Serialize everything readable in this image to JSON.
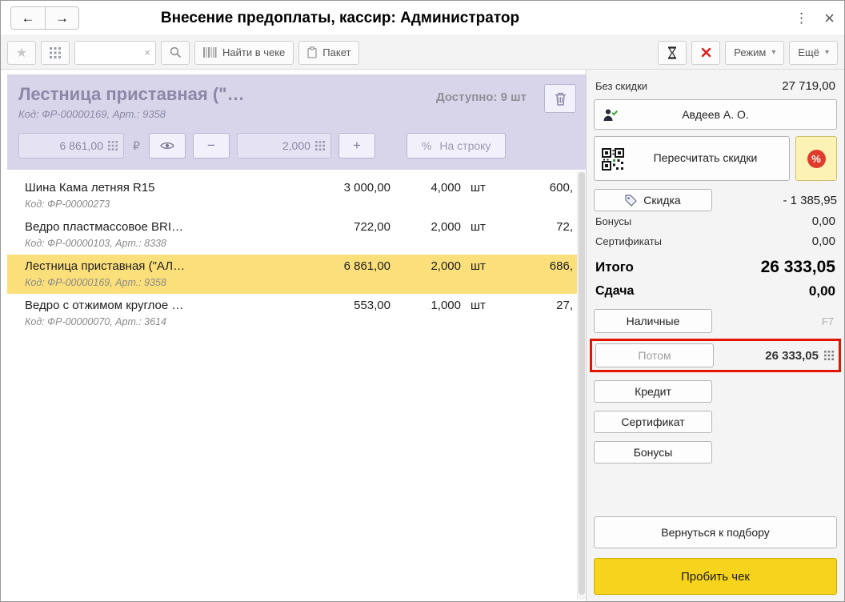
{
  "icons": {
    "back": "←",
    "forward": "→",
    "menu": "⋮",
    "close": "×",
    "star": "★",
    "clear": "×",
    "caret": "▾",
    "minus": "−",
    "plus": "+",
    "percent": "%"
  },
  "titlebar": {
    "title": "Внесение предоплаты, кассир: Администратор"
  },
  "toolbar": {
    "search_value": "",
    "find_in_check_label": "Найти в чеке",
    "packet_label": "Пакет",
    "mode_label": "Режим",
    "more_label": "Ещё"
  },
  "product_header": {
    "name": "Лестница приставная (\"…",
    "code": "Код: ФР-00000169, Арт.: 9358",
    "available_label": "Доступно: 9 шт",
    "price_value": "6 861,00",
    "currency": "₽",
    "qty_value": "2,000",
    "per_line_label": "На строку"
  },
  "items": [
    {
      "name": "Шина Кама летняя R15",
      "code": "Код: ФР-00000273",
      "price": "3 000,00",
      "qty": "4,000",
      "unit": "шт",
      "sum": "600,"
    },
    {
      "name": "Ведро пластмассовое BRI…",
      "code": "Код: ФР-00000103, Арт.: 8338",
      "price": "722,00",
      "qty": "2,000",
      "unit": "шт",
      "sum": "72,"
    },
    {
      "name": "Лестница приставная (\"АЛ…",
      "code": "Код: ФР-00000169, Арт.: 9358",
      "price": "6 861,00",
      "qty": "2,000",
      "unit": "шт",
      "sum": "686,"
    },
    {
      "name": "Ведро с отжимом  круглое …",
      "code": "Код: ФР-00000070, Арт.: 3614",
      "price": "553,00",
      "qty": "1,000",
      "unit": "шт",
      "sum": "27,"
    }
  ],
  "panel": {
    "no_discount_label": "Без скидки",
    "no_discount_value": "27 719,00",
    "customer_name": "Авдеев А. О.",
    "recalc_label": "Пересчитать скидки",
    "percent_badge": "%",
    "discount_button_label": "Скидка",
    "discount_value": "- 1 385,95",
    "bonuses_label": "Бонусы",
    "bonuses_value": "0,00",
    "certificates_label": "Сертификаты",
    "certificates_value": "0,00",
    "total_label": "Итого",
    "total_value": "26 333,05",
    "change_label": "Сдача",
    "change_value": "0,00",
    "cash_label": "Наличные",
    "cash_hotkey": "F7",
    "later_label": "Потом",
    "later_value": "26 333,05",
    "credit_label": "Кредит",
    "certificate_label": "Сертификат",
    "bonus_label": "Бонусы",
    "back_label": "Вернуться к подбору",
    "submit_label": "Пробить чек"
  }
}
